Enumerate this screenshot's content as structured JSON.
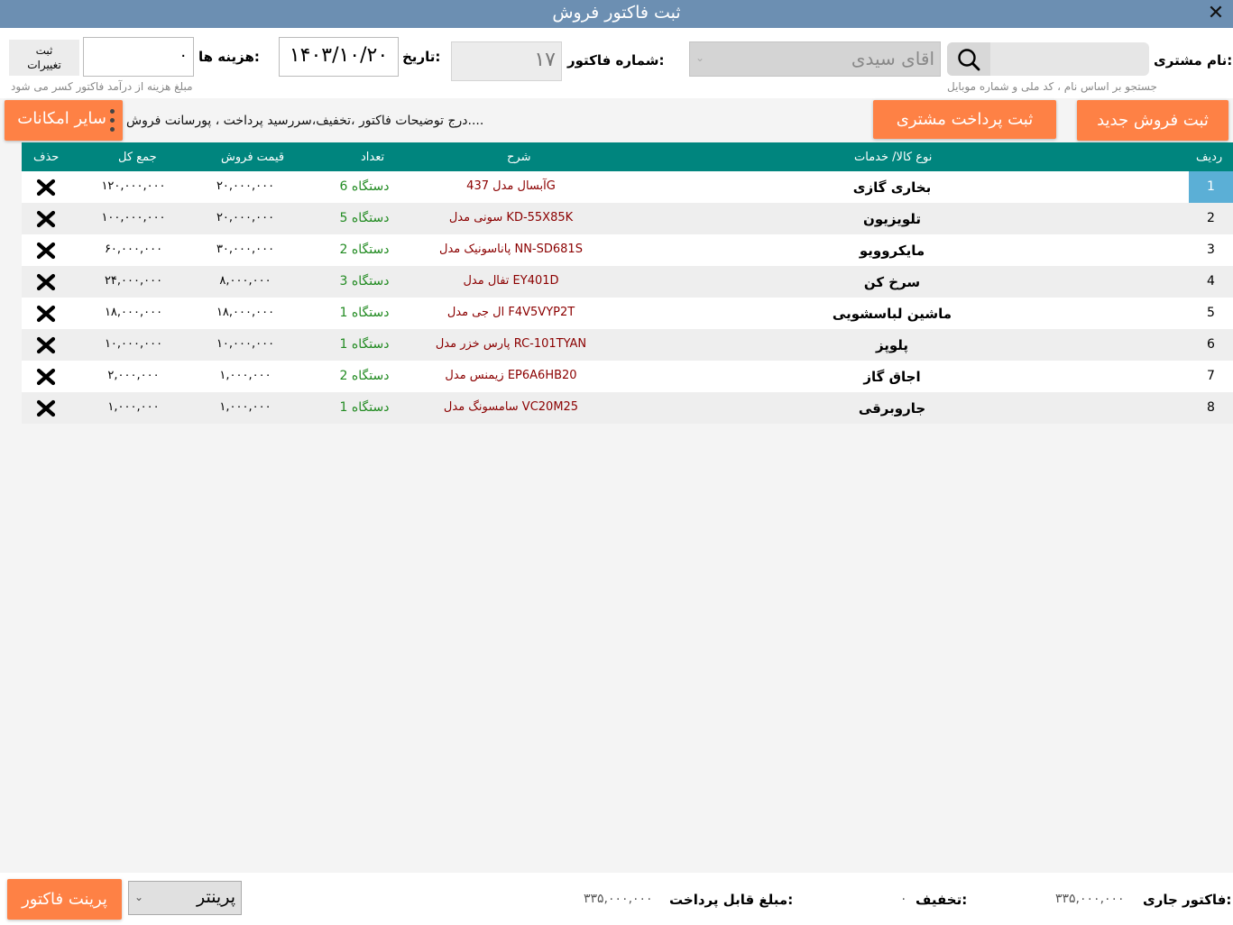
{
  "window": {
    "title": "ثبت فاکتور فروش",
    "close_glyph": "✕"
  },
  "header": {
    "customer_label": "نام مشتری:",
    "search_hint": "جستجو بر اساس نام ، کد ملی و شماره موبایل",
    "search_value": "",
    "customer_value": "اقای سیدی",
    "invoice_label": "شماره فاکتور:",
    "invoice_value": "۱۷",
    "date_label": "تاریخ:",
    "date_value": "۱۴۰۳/۱۰/۲۰",
    "cost_label": "هزینه ها:",
    "cost_value": "۰",
    "cost_hint": "مبلغ هزینه از درآمد فاکتور کسر می شود",
    "save_changes_label": "ثبت\nتغییرات"
  },
  "actions": {
    "new_sale_label": "ثبت فروش جدید",
    "customer_payment_label": "ثبت پرداخت مشتری",
    "extras_hint": "درج توضیحات فاکتور ،تخفیف،سررسید پرداخت ، پورسانت فروش....",
    "more_options_label": "سایر امکانات"
  },
  "table": {
    "columns": {
      "idx": "ردیف",
      "name": "نوع کالا/ خدمات",
      "desc": "شرح",
      "qty": "تعداد",
      "price": "قیمت فروش",
      "total": "جمع کل",
      "del": "حذف"
    },
    "rows": [
      {
        "idx": "1",
        "name": "بخاری گازی",
        "desc": "آبسال مدل 437G",
        "qty": "6 دستگاه",
        "price": "۲۰,۰۰۰,۰۰۰",
        "total": "۱۲۰,۰۰۰,۰۰۰",
        "selected": true
      },
      {
        "idx": "2",
        "name": "تلویزیون",
        "desc": "سونی مدل KD-55X85K",
        "qty": "5 دستگاه",
        "price": "۲۰,۰۰۰,۰۰۰",
        "total": "۱۰۰,۰۰۰,۰۰۰",
        "selected": false
      },
      {
        "idx": "3",
        "name": "مایکروویو",
        "desc": "پاناسونیک مدل NN-SD681S",
        "qty": "2 دستگاه",
        "price": "۳۰,۰۰۰,۰۰۰",
        "total": "۶۰,۰۰۰,۰۰۰",
        "selected": false
      },
      {
        "idx": "4",
        "name": "سرخ کن",
        "desc": "تفال مدل EY401D",
        "qty": "3 دستگاه",
        "price": "۸,۰۰۰,۰۰۰",
        "total": "۲۴,۰۰۰,۰۰۰",
        "selected": false
      },
      {
        "idx": "5",
        "name": "ماشین لباسشویی",
        "desc": "ال جی مدل F4V5VYP2T",
        "qty": "1 دستگاه",
        "price": "۱۸,۰۰۰,۰۰۰",
        "total": "۱۸,۰۰۰,۰۰۰",
        "selected": false
      },
      {
        "idx": "6",
        "name": "پلوپز",
        "desc": "پارس خزر مدل RC-101TYAN",
        "qty": "1 دستگاه",
        "price": "۱۰,۰۰۰,۰۰۰",
        "total": "۱۰,۰۰۰,۰۰۰",
        "selected": false
      },
      {
        "idx": "7",
        "name": "اجاق گاز",
        "desc": "زیمنس مدل EP6A6HB20",
        "qty": "2 دستگاه",
        "price": "۱,۰۰۰,۰۰۰",
        "total": "۲,۰۰۰,۰۰۰",
        "selected": false
      },
      {
        "idx": "8",
        "name": "جاروبرقی",
        "desc": "سامسونگ مدل VC20M25",
        "qty": "1 دستگاه",
        "price": "۱,۰۰۰,۰۰۰",
        "total": "۱,۰۰۰,۰۰۰",
        "selected": false
      }
    ]
  },
  "footer": {
    "current_invoice_label": "فاکتور جاری:",
    "current_invoice_value": "۳۳۵,۰۰۰,۰۰۰",
    "discount_label": "تخفیف:",
    "discount_value": "۰",
    "payable_label": "مبلغ قابل پرداخت:",
    "payable_value": "۳۳۵,۰۰۰,۰۰۰",
    "printer_value": "پرینتر",
    "print_label": "پرینت فاکتور"
  },
  "colors": {
    "titlebar": "#6c8fb2",
    "accent_orange": "#fe8145",
    "grid_header": "#00857e",
    "selected_index": "#5bafd6",
    "description_text": "#8b0000",
    "quantity_text": "#228b22"
  },
  "icons": {
    "search": "search-icon",
    "delete": "delete-x-icon",
    "dropdown": "chevron-down-icon",
    "more": "vertical-dots-icon"
  }
}
